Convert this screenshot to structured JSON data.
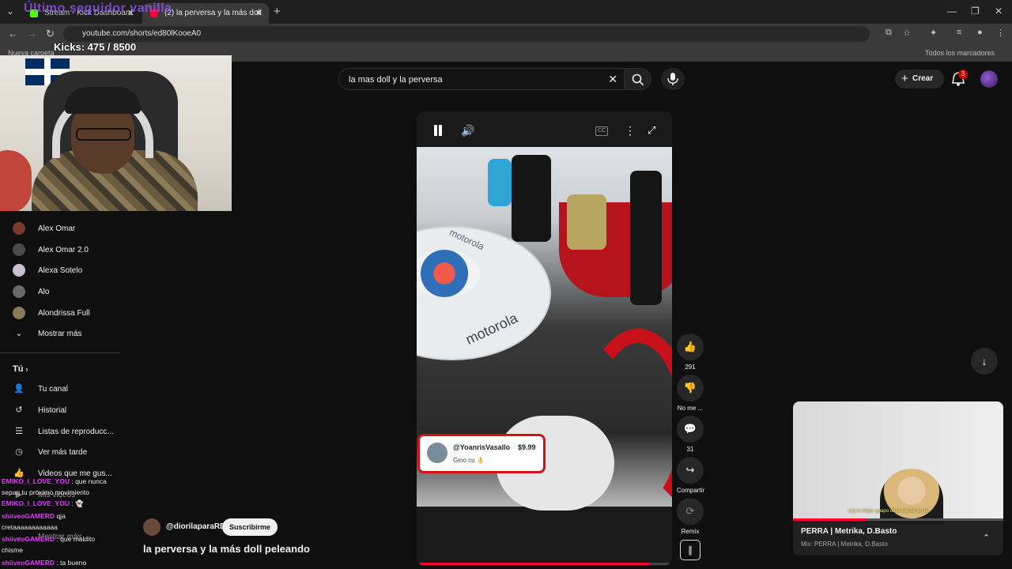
{
  "browser": {
    "tabs": [
      {
        "title": "Stream - Kick Dashboard",
        "favicon_color": "#53fc18"
      },
      {
        "title": "(2) la perversa y la más doll",
        "favicon_color": "#ff0033"
      }
    ],
    "url": "youtube.com/shorts/ed80lKooeA0",
    "bookmarks": {
      "left": "Nueva carpeta",
      "right": "Todos los marcadores"
    }
  },
  "stream_overlay": {
    "top_text": "Último seguidor vanilla",
    "kicks": "Kicks: 475 / 8500"
  },
  "search": {
    "query": "la mas doll y la perversa",
    "clear_icon": "close-icon",
    "search_icon": "search-icon",
    "mic_icon": "mic-icon"
  },
  "topbar": {
    "create_label": "Crear",
    "notifications": "3"
  },
  "sidebar": {
    "subscriptions": [
      {
        "label": "Alex Omar"
      },
      {
        "label": "Alex Omar 2.0"
      },
      {
        "label": "Alexa Sotelo"
      },
      {
        "label": "Alo"
      },
      {
        "label": "Alondrissa Full"
      }
    ],
    "show_more": "Mostrar más",
    "you_header": "Tú",
    "you_items": [
      {
        "label": "Tu canal",
        "icon": "channel-icon"
      },
      {
        "label": "Historial",
        "icon": "history-icon"
      },
      {
        "label": "Listas de reproducc...",
        "icon": "playlist-icon"
      },
      {
        "label": "Ver más tarde",
        "icon": "clock-icon"
      },
      {
        "label": "Videos que me gus...",
        "icon": "like-icon"
      },
      {
        "label": "Mis videos",
        "icon": "video-icon"
      },
      {
        "label": "Mostrar más",
        "icon": "chevron-down-icon"
      }
    ]
  },
  "chat": [
    {
      "user": "EMIKO_I_LOVE_YOU",
      "msg": ": que nunca",
      "user_color": "#e040fb"
    },
    {
      "user": "",
      "msg": "sepan tu próximo movimiento",
      "user_color": ""
    },
    {
      "user": "EMIKO_I_LOVE_YOU",
      "msg": ": 👻",
      "user_color": "#e040fb"
    },
    {
      "user": "shiiveoGAMERD",
      "msg": "qja",
      "user_color": "#e040fb"
    },
    {
      "user": "",
      "msg": "cretaaaaaaaaaaaa",
      "user_color": ""
    },
    {
      "user": "shiiveoGAMERD",
      "msg": ": que maldito",
      "user_color": "#e040fb"
    },
    {
      "user": "",
      "msg": "chisme",
      "user_color": ""
    },
    {
      "user": "shiiveoGAMERD",
      "msg": ": ta bueno",
      "user_color": "#e040fb"
    },
    {
      "user": "",
      "msg": "Explorar",
      "user_color": ""
    }
  ],
  "player": {
    "brand_text": "motorola",
    "donation": {
      "user": "@YoanrisVasallo",
      "amount": "$9.99",
      "message": "Gino cu 👌"
    },
    "progress": 0.92
  },
  "actions": {
    "like_count": "291",
    "dislike_label": "No me ...",
    "comment_count": "31",
    "share_label": "Compartir",
    "remix_label": "Remix"
  },
  "video": {
    "channel": "@diorilaparaRD",
    "subscribe_label": "Suscribirme",
    "title": "la perversa y la más doll peleando"
  },
  "mini_player": {
    "title": "PERRA | Metrika, D.Basto",
    "subtitle": "Mix: PERRA | Metrika, D.Basto",
    "caption": "soy tu mejor guapo de la doll de la city",
    "progress": 0.35
  }
}
